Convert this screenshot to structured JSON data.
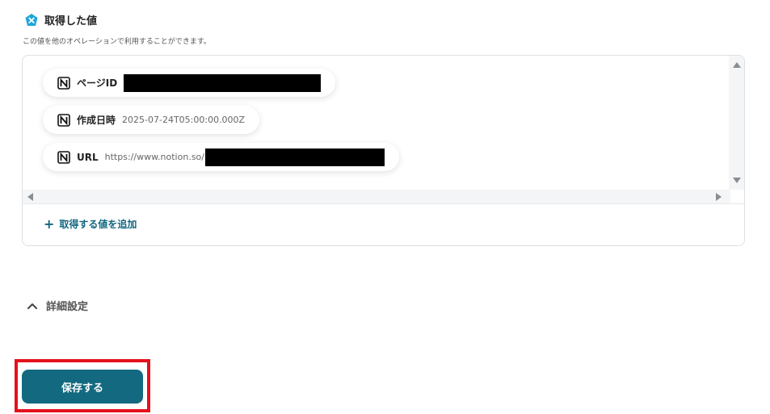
{
  "section": {
    "title": "取得した値",
    "description": "この値を他のオペレーションで利用することができます。",
    "icon": "yoom-badge-icon"
  },
  "fields": [
    {
      "label": "ページID",
      "value": "",
      "redacted": true
    },
    {
      "label": "作成日時",
      "value": "2025-07-24T05:00:00.000Z",
      "redacted": false
    },
    {
      "label": "URL",
      "value": "https://www.notion.so/",
      "redacted": true
    }
  ],
  "field_icon": "notion-icon",
  "add_value_label": "取得する値を追加",
  "advanced": {
    "label": "詳細設定",
    "expanded": true
  },
  "save_button": {
    "label": "保存する"
  },
  "colors": {
    "accent": "#136a80",
    "link": "#12677e",
    "highlight": "#e3121d",
    "badge": "#1ea7d6"
  }
}
